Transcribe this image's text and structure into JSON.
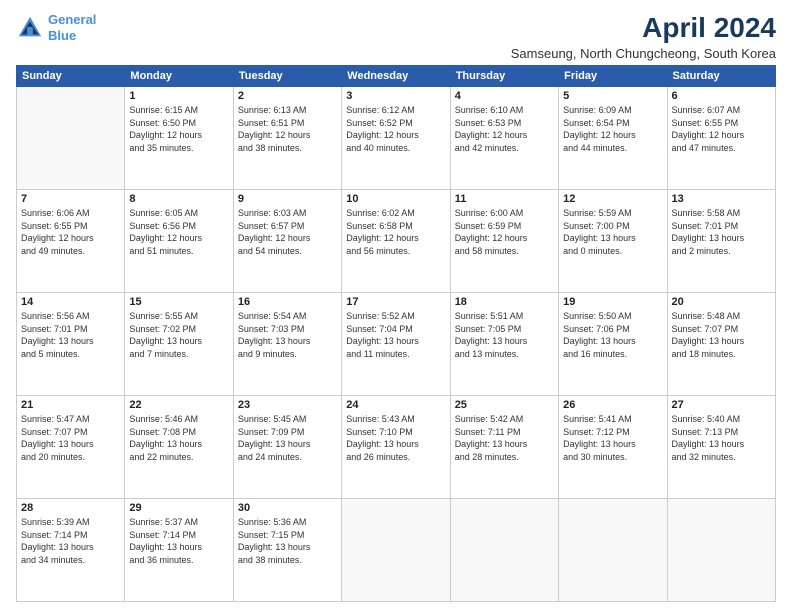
{
  "logo": {
    "line1": "General",
    "line2": "Blue"
  },
  "title": "April 2024",
  "subtitle": "Samseung, North Chungcheong, South Korea",
  "days_header": [
    "Sunday",
    "Monday",
    "Tuesday",
    "Wednesday",
    "Thursday",
    "Friday",
    "Saturday"
  ],
  "weeks": [
    [
      {
        "day": "",
        "info": ""
      },
      {
        "day": "1",
        "info": "Sunrise: 6:15 AM\nSunset: 6:50 PM\nDaylight: 12 hours\nand 35 minutes."
      },
      {
        "day": "2",
        "info": "Sunrise: 6:13 AM\nSunset: 6:51 PM\nDaylight: 12 hours\nand 38 minutes."
      },
      {
        "day": "3",
        "info": "Sunrise: 6:12 AM\nSunset: 6:52 PM\nDaylight: 12 hours\nand 40 minutes."
      },
      {
        "day": "4",
        "info": "Sunrise: 6:10 AM\nSunset: 6:53 PM\nDaylight: 12 hours\nand 42 minutes."
      },
      {
        "day": "5",
        "info": "Sunrise: 6:09 AM\nSunset: 6:54 PM\nDaylight: 12 hours\nand 44 minutes."
      },
      {
        "day": "6",
        "info": "Sunrise: 6:07 AM\nSunset: 6:55 PM\nDaylight: 12 hours\nand 47 minutes."
      }
    ],
    [
      {
        "day": "7",
        "info": "Sunrise: 6:06 AM\nSunset: 6:55 PM\nDaylight: 12 hours\nand 49 minutes."
      },
      {
        "day": "8",
        "info": "Sunrise: 6:05 AM\nSunset: 6:56 PM\nDaylight: 12 hours\nand 51 minutes."
      },
      {
        "day": "9",
        "info": "Sunrise: 6:03 AM\nSunset: 6:57 PM\nDaylight: 12 hours\nand 54 minutes."
      },
      {
        "day": "10",
        "info": "Sunrise: 6:02 AM\nSunset: 6:58 PM\nDaylight: 12 hours\nand 56 minutes."
      },
      {
        "day": "11",
        "info": "Sunrise: 6:00 AM\nSunset: 6:59 PM\nDaylight: 12 hours\nand 58 minutes."
      },
      {
        "day": "12",
        "info": "Sunrise: 5:59 AM\nSunset: 7:00 PM\nDaylight: 13 hours\nand 0 minutes."
      },
      {
        "day": "13",
        "info": "Sunrise: 5:58 AM\nSunset: 7:01 PM\nDaylight: 13 hours\nand 2 minutes."
      }
    ],
    [
      {
        "day": "14",
        "info": "Sunrise: 5:56 AM\nSunset: 7:01 PM\nDaylight: 13 hours\nand 5 minutes."
      },
      {
        "day": "15",
        "info": "Sunrise: 5:55 AM\nSunset: 7:02 PM\nDaylight: 13 hours\nand 7 minutes."
      },
      {
        "day": "16",
        "info": "Sunrise: 5:54 AM\nSunset: 7:03 PM\nDaylight: 13 hours\nand 9 minutes."
      },
      {
        "day": "17",
        "info": "Sunrise: 5:52 AM\nSunset: 7:04 PM\nDaylight: 13 hours\nand 11 minutes."
      },
      {
        "day": "18",
        "info": "Sunrise: 5:51 AM\nSunset: 7:05 PM\nDaylight: 13 hours\nand 13 minutes."
      },
      {
        "day": "19",
        "info": "Sunrise: 5:50 AM\nSunset: 7:06 PM\nDaylight: 13 hours\nand 16 minutes."
      },
      {
        "day": "20",
        "info": "Sunrise: 5:48 AM\nSunset: 7:07 PM\nDaylight: 13 hours\nand 18 minutes."
      }
    ],
    [
      {
        "day": "21",
        "info": "Sunrise: 5:47 AM\nSunset: 7:07 PM\nDaylight: 13 hours\nand 20 minutes."
      },
      {
        "day": "22",
        "info": "Sunrise: 5:46 AM\nSunset: 7:08 PM\nDaylight: 13 hours\nand 22 minutes."
      },
      {
        "day": "23",
        "info": "Sunrise: 5:45 AM\nSunset: 7:09 PM\nDaylight: 13 hours\nand 24 minutes."
      },
      {
        "day": "24",
        "info": "Sunrise: 5:43 AM\nSunset: 7:10 PM\nDaylight: 13 hours\nand 26 minutes."
      },
      {
        "day": "25",
        "info": "Sunrise: 5:42 AM\nSunset: 7:11 PM\nDaylight: 13 hours\nand 28 minutes."
      },
      {
        "day": "26",
        "info": "Sunrise: 5:41 AM\nSunset: 7:12 PM\nDaylight: 13 hours\nand 30 minutes."
      },
      {
        "day": "27",
        "info": "Sunrise: 5:40 AM\nSunset: 7:13 PM\nDaylight: 13 hours\nand 32 minutes."
      }
    ],
    [
      {
        "day": "28",
        "info": "Sunrise: 5:39 AM\nSunset: 7:14 PM\nDaylight: 13 hours\nand 34 minutes."
      },
      {
        "day": "29",
        "info": "Sunrise: 5:37 AM\nSunset: 7:14 PM\nDaylight: 13 hours\nand 36 minutes."
      },
      {
        "day": "30",
        "info": "Sunrise: 5:36 AM\nSunset: 7:15 PM\nDaylight: 13 hours\nand 38 minutes."
      },
      {
        "day": "",
        "info": ""
      },
      {
        "day": "",
        "info": ""
      },
      {
        "day": "",
        "info": ""
      },
      {
        "day": "",
        "info": ""
      }
    ]
  ]
}
